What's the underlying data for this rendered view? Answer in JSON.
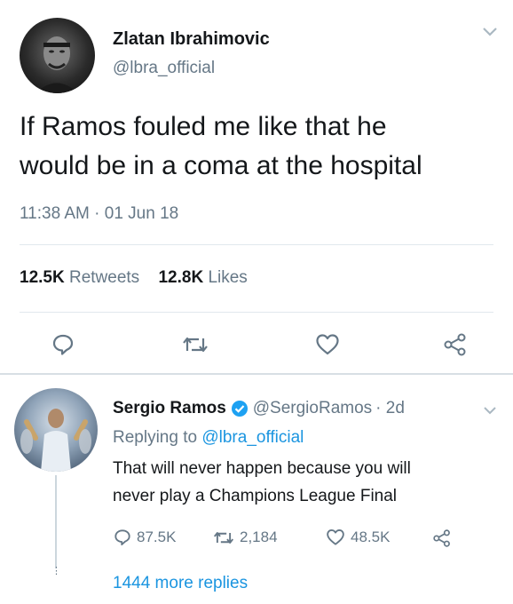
{
  "main_tweet": {
    "author_name": "Zlatan Ibrahimovic",
    "author_handle": "@lbra_official",
    "text_line1": "If Ramos fouled me like that he",
    "text_line2": "would be in a coma at the hospital",
    "timestamp": "11:38 AM · 01 Jun 18",
    "retweets_count": "12.5K",
    "retweets_label": "Retweets",
    "likes_count": "12.8K",
    "likes_label": "Likes"
  },
  "reply": {
    "author_name": "Sergio Ramos",
    "author_handle": "@SergioRamos",
    "age": "· 2d",
    "replying_to_label": "Replying to",
    "replying_to_handle": "@lbra_official",
    "text_line1": "That will never happen because you will",
    "text_line2": "never play a Champions League Final",
    "reply_count": "87.5K",
    "retweet_count": "2,184",
    "like_count": "48.5K",
    "more_replies": "1444 more replies"
  },
  "colors": {
    "link": "#1b95e0",
    "muted": "#657786",
    "verified": "#1da1f2"
  }
}
